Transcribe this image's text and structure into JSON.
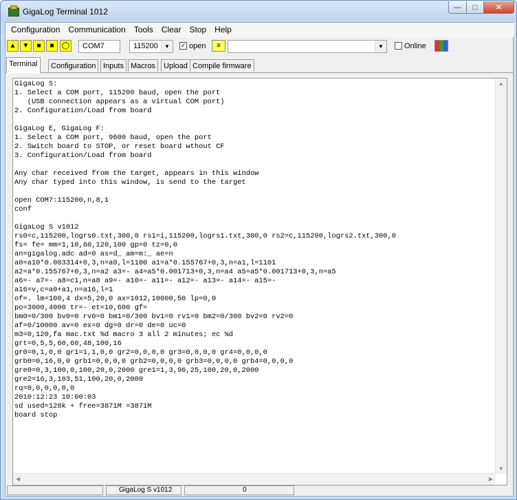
{
  "window": {
    "title": "GigaLog Terminal 1012"
  },
  "menu": [
    "Configuration",
    "Communication",
    "Tools",
    "Clear",
    "Stop",
    "Help"
  ],
  "toolbar": {
    "port": "COM7",
    "baud": "115200",
    "open_label": "open",
    "open_checked": true,
    "online_label": "Online",
    "online_checked": false,
    "command_value": ""
  },
  "tabs": [
    "Terminal",
    "Configuration",
    "Inputs",
    "Macros",
    "Upload",
    "Compile firmware"
  ],
  "terminal": {
    "text": "GigaLog S:\n1. Select a COM port, 115200 baud, open the port\n   (USB connection appears as a virtual COM port)\n2. Configuration/Load from board\n\nGigaLog E, GigaLog F:\n1. Select a COM port, 9600 baud, open the port\n2. Switch board to STOP, or reset board wthout CF\n3. Configuration/Load from board\n\nAny char received from the target, appears in this window\nAny char typed into this window, is send to the target\n\nopen COM7:115200,n,8,1\nconf\n\nGigaLog S v1012\nrs0=c,115200,logrs0.txt,300,0 rs1=i,115200,logrs1.txt,300,0 rs2=c,115200,logrs2.txt,300,0\nfs= fe= mm=1,10,60,120,100 gp=0 tz=0,0\nan=gigalog.adc ad=0 as=d_ am=m:_ ae=n\na0=a10*0.003314+0,3,n=a0,l=1100 a1=a*0.155767+0,3,n=a1,l=1101\na2=a*0.155767+0,3,n=a2 a3=- a4=a5*0.001713+0,3,n=a4 a5=a5*0.001713+0,3,n=a5\na6=- a7=- a8=c1,n=a8 a9=- a10=- a11=- a12=- a13=- a14=- a15=-\na16=v,c=a0+a1,n=a16,l=1\nof=. lm=100,4 dx=5,20,0 ax=1012,10000,50 lp=0,0\npo=3000,4000 tr=- et=10,600 gf=\nbm0=0/300 bv0=0 rv0=0 bm1=0/300 bv1=0 rv1=0 bm2=0/300 bv2=0 rv2=0\naf=0/10000 av=0 ex=0 dg=0 dr=0 de=0 uc=0\nm3=0,120,fa mac.txt %d macro 3 all 2 minutes; ec %d\ngrt=0,5,5,60,60,48,100,16\ngr0=0,1,0,0 gr1=1,1,0,0 gr2=0,0,0,0 gr3=0,0,0,0 gr4=0,0,0,0\ngrb0=0,16,0,0 grb1=0,0,0,0 grb2=0,0,0,0 grb3=0,0,0,0 grb4=0,0,0,0\ngre0=0,3,100,0,100,20,0,2000 gre1=1,3,96,25,100,20,0,2000\ngre2=16,3,103,51,100,20,0,2000\nrq=0,0,0,0,0,0\n2010:12:23 10:00:03\nsd used=128k + free=3871M =3871M\nboard stop"
  },
  "status": {
    "panel1": "",
    "device": "GigaLog S v1012",
    "count": "0"
  }
}
